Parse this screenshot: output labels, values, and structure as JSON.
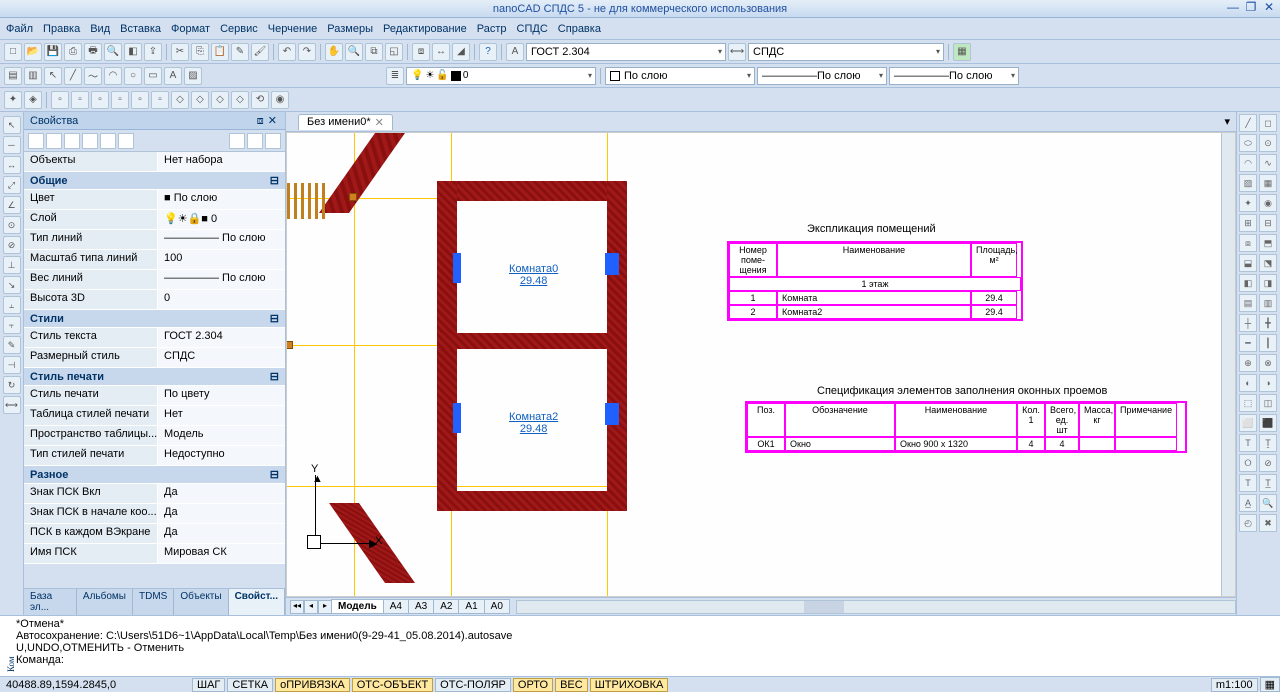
{
  "app": {
    "title": "nanoCAD СПДС 5 - не для коммерческого использования"
  },
  "menu": [
    "Файл",
    "Правка",
    "Вид",
    "Вставка",
    "Формат",
    "Сервис",
    "Черчение",
    "Размеры",
    "Редактирование",
    "Растр",
    "СПДС",
    "Справка"
  ],
  "tb1": {
    "textstyle": "ГОСТ 2.304",
    "dimstyle": "СПДС"
  },
  "tb2": {
    "layer": "0",
    "colorlabel": "По слою",
    "ltypelabel": "По слою",
    "lweightlabel": "По слою"
  },
  "props": {
    "title": "Свойства",
    "objects_k": "Объекты",
    "objects_v": "Нет набора",
    "groups": [
      {
        "name": "Общие",
        "rows": [
          [
            "Цвет",
            "■ По слою"
          ],
          [
            "Слой",
            "💡☀🔒■ 0"
          ],
          [
            "Тип линий",
            "――――― По слою"
          ],
          [
            "Масштаб типа линий",
            "100"
          ],
          [
            "Вес линий",
            "――――― По слою"
          ],
          [
            "Высота 3D",
            "0"
          ]
        ]
      },
      {
        "name": "Стили",
        "rows": [
          [
            "Стиль текста",
            "ГОСТ 2.304"
          ],
          [
            "Размерный стиль",
            "СПДС"
          ]
        ]
      },
      {
        "name": "Стиль печати",
        "rows": [
          [
            "Стиль печати",
            "По цвету"
          ],
          [
            "Таблица стилей печати",
            "Нет"
          ],
          [
            "Пространство таблицы...",
            "Модель"
          ],
          [
            "Тип стилей печати",
            "Недоступно"
          ]
        ]
      },
      {
        "name": "Разное",
        "rows": [
          [
            "Знак ПСК Вкл",
            "Да"
          ],
          [
            "Знак ПСК в начале коо...",
            "Да"
          ],
          [
            "ПСК в каждом ВЭкране",
            "Да"
          ],
          [
            "Имя ПСК",
            "Мировая СК"
          ]
        ]
      }
    ],
    "tabs": [
      "База эл...",
      "Альбомы",
      "TDMS",
      "Объекты",
      "Свойст..."
    ],
    "activeTab": 4
  },
  "doc": {
    "tabname": "Без имени0*"
  },
  "modeltabs": [
    "Модель",
    "А4",
    "А3",
    "А2",
    "А1",
    "А0"
  ],
  "expl": {
    "title": "Экспликация помещений",
    "hdr": [
      "Номер поме-щения",
      "Наименование",
      "Площадь, м²"
    ],
    "floor": "1 этаж",
    "rows": [
      [
        "1",
        "Комната",
        "29.4"
      ],
      [
        "2",
        "Комната2",
        "29.4"
      ]
    ]
  },
  "spec": {
    "title": "Спецификация элементов заполнения оконных проемов",
    "hdr": [
      "Поз.",
      "Обозначение",
      "Наименование",
      "Кол. 1",
      "Всего, ед. шт",
      "Масса, кг",
      "Примечание"
    ],
    "rows": [
      [
        "ОК1",
        "Окно",
        "Окно 900 x 1320",
        "4",
        "4",
        "",
        ""
      ]
    ]
  },
  "rooms": {
    "r1name": "Комната0",
    "r1area": "29.48",
    "r2name": "Комната2",
    "r2area": "29.48"
  },
  "cmd": {
    "side": "Ком",
    "l1": "*Отмена*",
    "l2": "Автосохранение: C:\\Users\\51D6~1\\AppData\\Local\\Temp\\Без имени0(9-29-41_05.08.2014).autosave",
    "l3": "U,UNDO,ОТМЕНИТЬ - Отменить",
    "l4": "Команда:"
  },
  "status": {
    "coords": "40488.89,1594.2845,0",
    "toggles": [
      {
        "t": "ШАГ",
        "on": false
      },
      {
        "t": "СЕТКА",
        "on": false
      },
      {
        "t": "оПРИВЯЗКА",
        "on": true
      },
      {
        "t": "ОТС-ОБЪЕКТ",
        "on": true
      },
      {
        "t": "ОТС-ПОЛЯР",
        "on": false
      },
      {
        "t": "ОРТО",
        "on": true
      },
      {
        "t": "ВЕС",
        "on": true
      },
      {
        "t": "ШТРИХОВКА",
        "on": true
      }
    ],
    "scale": "m1:100"
  }
}
